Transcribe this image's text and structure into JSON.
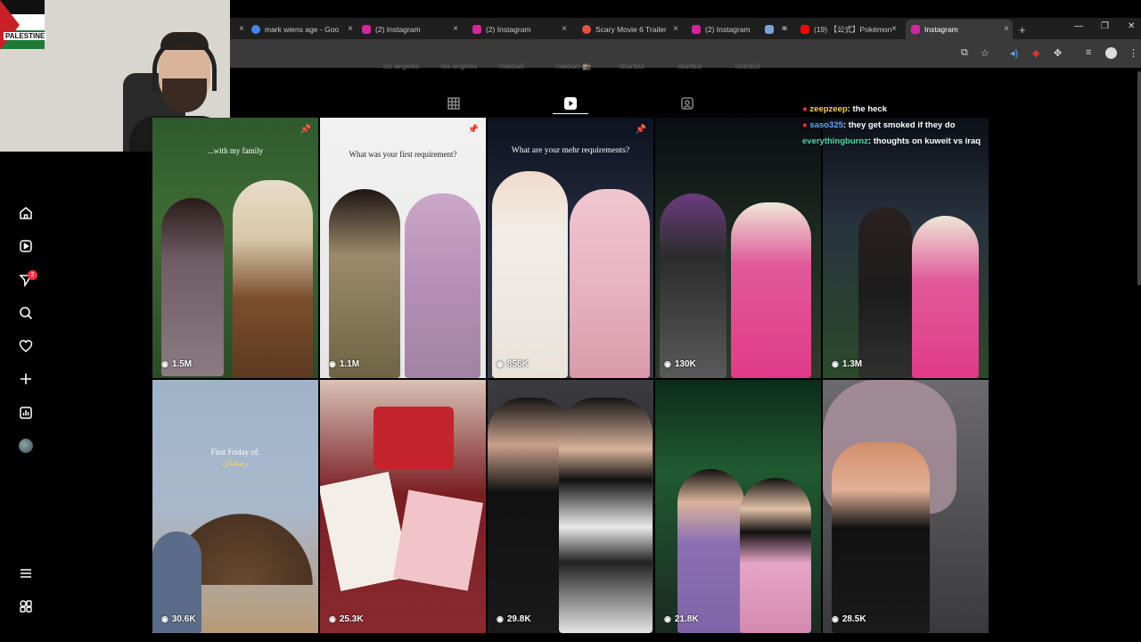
{
  "browser": {
    "tabs": [
      {
        "label": "mark wiens age - Goo",
        "favicon_color": "#4285f4"
      },
      {
        "label": "(2) Instagram",
        "favicon_color": "#d6249f"
      },
      {
        "label": "(2) Instagram",
        "favicon_color": "#d6249f"
      },
      {
        "label": "Scary Movie 6 Trailer",
        "favicon_color": "#e5533d"
      },
      {
        "label": "(2) Instagram",
        "favicon_color": "#d6249f"
      },
      {
        "label": "",
        "favicon_color": "#7aa2d6"
      },
      {
        "label": "(19) 【公式】Pokémon",
        "favicon_color": "#ff0000"
      },
      {
        "label": "Instagram",
        "favicon_color": "#d6249f"
      }
    ],
    "new_tab_label": "+",
    "close_glyph": "×"
  },
  "webcam": {
    "flag_text": "PALESTINE"
  },
  "chat": [
    {
      "user": "zeepzeep",
      "message": ": the heck",
      "color": "#ffd24a"
    },
    {
      "user": "saso325",
      "message": ": they get smoked if they do",
      "color": "#5aa7ff"
    },
    {
      "user": "everythingburnz",
      "message": ": thoughts on kuweit vs iraq",
      "color": "#4ad6a0"
    }
  ],
  "grid": [
    {
      "views": "1.5M",
      "pinned": true,
      "caption": "...with my family"
    },
    {
      "views": "1.1M",
      "pinned": true,
      "caption": "What was your first requirement?"
    },
    {
      "views": "856K",
      "pinned": true,
      "caption": "What are your mehr requirements?"
    },
    {
      "views": "130K",
      "pinned": false,
      "caption": ""
    },
    {
      "views": "1.3M",
      "pinned": false,
      "caption": ""
    },
    {
      "views": "30.6K",
      "pinned": false,
      "caption": "First Friday of:",
      "caption2": "رمضان"
    },
    {
      "views": "25.3K",
      "pinned": false,
      "caption": ""
    },
    {
      "views": "29.8K",
      "pinned": false,
      "caption": ""
    },
    {
      "views": "21.8K",
      "pinned": false,
      "caption": ""
    },
    {
      "views": "28.5K",
      "pinned": false,
      "caption": ""
    }
  ],
  "nav": {
    "notification_count": "2"
  },
  "faded_labels": [
    "los angeles",
    "los angeles",
    "makkah",
    "makkah 🕋",
    "istanbul",
    "istanbul",
    "istanbul"
  ]
}
